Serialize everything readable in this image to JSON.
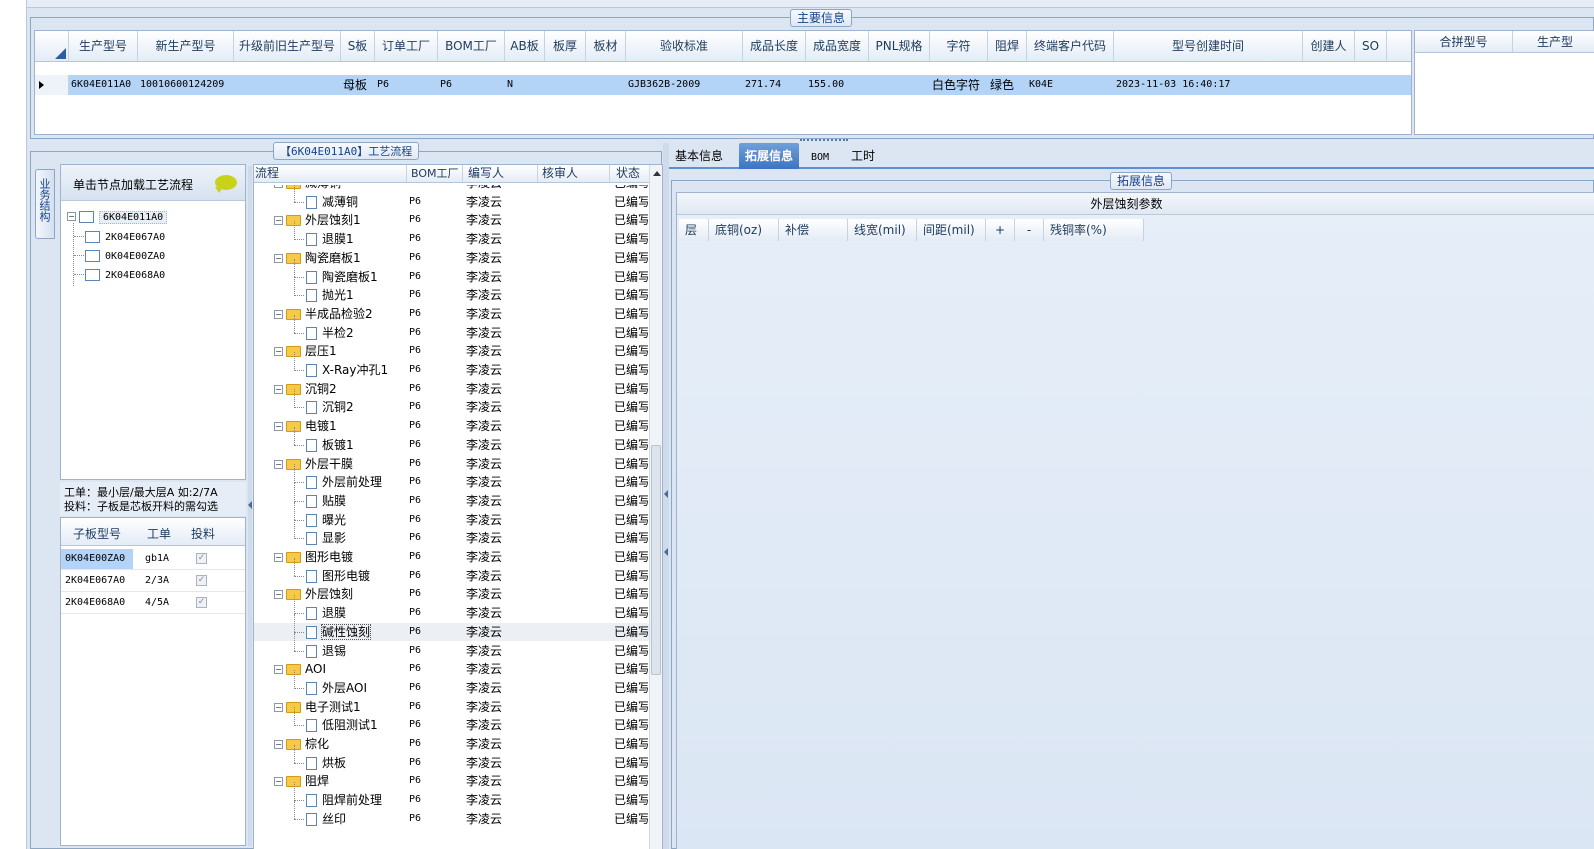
{
  "main_info": {
    "title": "主要信息",
    "columns": [
      "生产型号",
      "新生产型号",
      "升级前旧生产型号",
      "S板",
      "订单工厂",
      "BOM工厂",
      "AB板",
      "板厚",
      "板材",
      "验收标准",
      "成品长度",
      "成品宽度",
      "PNL规格",
      "字符",
      "阻焊",
      "终端客户代码",
      "型号创建时间",
      "创建人",
      "SO"
    ],
    "row": {
      "prod_model": "6K04E011A0",
      "new_model": "10010600124209",
      "old_model": "",
      "s_board": "母板",
      "order_factory": "P6",
      "bom_factory": "P6",
      "ab_board": "N",
      "thickness": "",
      "material": "",
      "standard": "GJB362B-2009",
      "length": "271.74",
      "width": "155.00",
      "pnl": "",
      "char": "白色字符",
      "solder_mask": "绿色",
      "customer_code": "K04E",
      "created_time": "2023-11-03 16:40:17",
      "creator": "",
      "so": ""
    },
    "merge_columns": [
      "合拼型号",
      "生产型"
    ]
  },
  "process_flow": {
    "title": "【6K04E011A0】工艺流程",
    "vertical_tab": "业务结构",
    "hint": "单击节点加载工艺流程",
    "tree": {
      "root": "6K04E011A0",
      "children": [
        "2K04E067A0",
        "0K04E00ZA0",
        "2K04E068A0"
      ]
    },
    "note_line1": "工单：最小层/最大层A 如:2/7A",
    "note_line2": "投料：子板是芯板开料的需勾选",
    "sub_table": {
      "columns": [
        "子板型号",
        "工单",
        "投料"
      ],
      "rows": [
        {
          "model": "0K04E00ZA0",
          "order": "gb1A"
        },
        {
          "model": "2K04E067A0",
          "order": "2/3A"
        },
        {
          "model": "2K04E068A0",
          "order": "4/5A"
        }
      ]
    },
    "flow_columns": [
      "流程",
      "BOM工厂",
      "编写人",
      "核审人",
      "状态"
    ],
    "flow_rows": [
      {
        "name": "减薄铜",
        "type": "folder",
        "factory": "P6",
        "author": "李凌云",
        "status": "已编写"
      },
      {
        "name": "减薄铜",
        "type": "leaf",
        "factory": "P6",
        "author": "李凌云",
        "status": "已编写"
      },
      {
        "name": "外层蚀刻1",
        "type": "folder",
        "factory": "P6",
        "author": "李凌云",
        "status": "已编写"
      },
      {
        "name": "退膜1",
        "type": "leaf",
        "factory": "P6",
        "author": "李凌云",
        "status": "已编写"
      },
      {
        "name": "陶瓷磨板1",
        "type": "folder",
        "factory": "P6",
        "author": "李凌云",
        "status": "已编写"
      },
      {
        "name": "陶瓷磨板1",
        "type": "leaf",
        "factory": "P6",
        "author": "李凌云",
        "status": "已编写"
      },
      {
        "name": "抛光1",
        "type": "leaf",
        "factory": "P6",
        "author": "李凌云",
        "status": "已编写"
      },
      {
        "name": "半成品检验2",
        "type": "folder",
        "factory": "P6",
        "author": "李凌云",
        "status": "已编写"
      },
      {
        "name": "半检2",
        "type": "leaf",
        "factory": "P6",
        "author": "李凌云",
        "status": "已编写"
      },
      {
        "name": "层压1",
        "type": "folder",
        "factory": "P6",
        "author": "李凌云",
        "status": "已编写"
      },
      {
        "name": "X-Ray冲孔1",
        "type": "leaf",
        "factory": "P6",
        "author": "李凌云",
        "status": "已编写"
      },
      {
        "name": "沉铜2",
        "type": "folder",
        "factory": "P6",
        "author": "李凌云",
        "status": "已编写"
      },
      {
        "name": "沉铜2",
        "type": "leaf",
        "factory": "P6",
        "author": "李凌云",
        "status": "已编写"
      },
      {
        "name": "电镀1",
        "type": "folder",
        "factory": "P6",
        "author": "李凌云",
        "status": "已编写"
      },
      {
        "name": "板镀1",
        "type": "leaf",
        "factory": "P6",
        "author": "李凌云",
        "status": "已编写"
      },
      {
        "name": "外层干膜",
        "type": "folder",
        "factory": "P6",
        "author": "李凌云",
        "status": "已编写"
      },
      {
        "name": "外层前处理",
        "type": "leaf",
        "factory": "P6",
        "author": "李凌云",
        "status": "已编写"
      },
      {
        "name": "贴膜",
        "type": "leaf",
        "factory": "P6",
        "author": "李凌云",
        "status": "已编写"
      },
      {
        "name": "曝光",
        "type": "leaf",
        "factory": "P6",
        "author": "李凌云",
        "status": "已编写"
      },
      {
        "name": "显影",
        "type": "leaf",
        "factory": "P6",
        "author": "李凌云",
        "status": "已编写"
      },
      {
        "name": "图形电镀",
        "type": "folder",
        "factory": "P6",
        "author": "李凌云",
        "status": "已编写"
      },
      {
        "name": "图形电镀",
        "type": "leaf",
        "factory": "P6",
        "author": "李凌云",
        "status": "已编写"
      },
      {
        "name": "外层蚀刻",
        "type": "folder",
        "factory": "P6",
        "author": "李凌云",
        "status": "已编写"
      },
      {
        "name": "退膜",
        "type": "leaf",
        "factory": "P6",
        "author": "李凌云",
        "status": "已编写"
      },
      {
        "name": "碱性蚀刻",
        "type": "leaf",
        "factory": "P6",
        "author": "李凌云",
        "status": "已编写",
        "selected": true
      },
      {
        "name": "退锡",
        "type": "leaf",
        "factory": "P6",
        "author": "李凌云",
        "status": "已编写"
      },
      {
        "name": "AOI",
        "type": "folder",
        "factory": "P6",
        "author": "李凌云",
        "status": "已编写"
      },
      {
        "name": "外层AOI",
        "type": "leaf",
        "factory": "P6",
        "author": "李凌云",
        "status": "已编写"
      },
      {
        "name": "电子测试1",
        "type": "folder",
        "factory": "P6",
        "author": "李凌云",
        "status": "已编写"
      },
      {
        "name": "低阻测试1",
        "type": "leaf",
        "factory": "P6",
        "author": "李凌云",
        "status": "已编写"
      },
      {
        "name": "棕化",
        "type": "folder",
        "factory": "P6",
        "author": "李凌云",
        "status": "已编写"
      },
      {
        "name": "烘板",
        "type": "leaf",
        "factory": "P6",
        "author": "李凌云",
        "status": "已编写"
      },
      {
        "name": "阻焊",
        "type": "folder",
        "factory": "P6",
        "author": "李凌云",
        "status": "已编写"
      },
      {
        "name": "阻焊前处理",
        "type": "leaf",
        "factory": "P6",
        "author": "李凌云",
        "status": "已编写"
      },
      {
        "name": "丝印",
        "type": "leaf",
        "factory": "P6",
        "author": "李凌云",
        "status": "已编写"
      }
    ]
  },
  "detail": {
    "tabs": [
      "基本信息",
      "拓展信息",
      "BOM",
      "工时"
    ],
    "active_tab": "拓展信息",
    "group_title": "拓展信息",
    "section_title": "外层蚀刻参数",
    "columns": [
      "层",
      "底铜(oz)",
      "补偿",
      "线宽(mil)",
      "间距(mil)",
      "+",
      "-",
      "残铜率(%)"
    ]
  },
  "colors": {
    "selection": "#b3d4f7",
    "active_tab": "#3d74c2",
    "background": "#dce6f2"
  }
}
